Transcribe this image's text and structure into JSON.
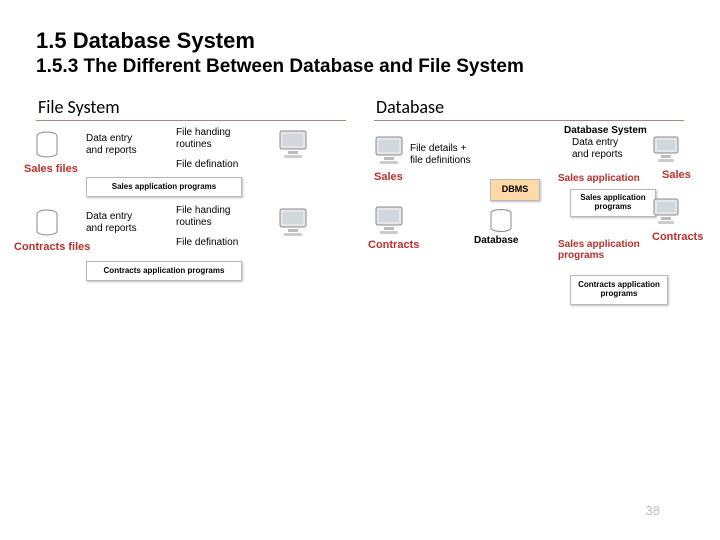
{
  "section": {
    "num": "1.5",
    "title": "Database System"
  },
  "subsection": {
    "num": "1.5.3",
    "title": "The Different Between Database and File System"
  },
  "left": {
    "title": "File System",
    "files1": "Sales files",
    "files2": "Contracts files",
    "entry": "Data entry\nand reports",
    "handling": "File handing\nroutines",
    "defin": "File defination",
    "box1": "Sales application programs",
    "box2": "Contracts application programs"
  },
  "right": {
    "title": "Database",
    "dbsys": "Database System",
    "details": "File details +\nfile definitions",
    "sales": "Sales",
    "contracts": "Contracts",
    "dbms": "DBMS",
    "database": "Database",
    "entry": "Data entry\nand reports",
    "salesapp": "Sales application",
    "salesappprog": "Sales application\nprograms",
    "box1": "Sales application programs",
    "box2": "Contracts application programs"
  },
  "page": "38"
}
